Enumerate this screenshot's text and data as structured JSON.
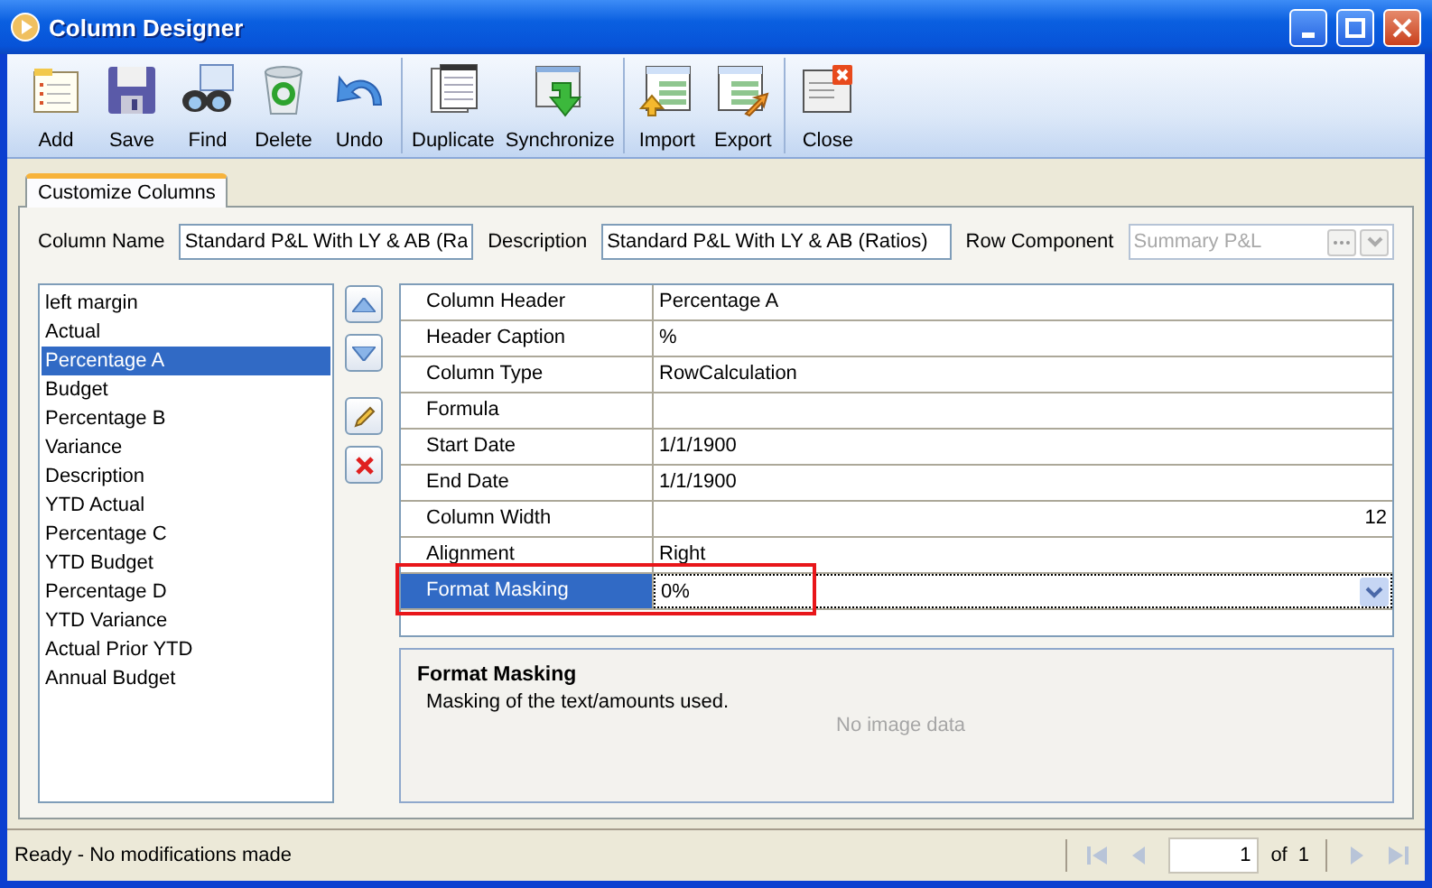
{
  "window": {
    "title": "Column Designer"
  },
  "toolbar": {
    "groups": [
      [
        {
          "label": "Add"
        },
        {
          "label": "Save"
        },
        {
          "label": "Find"
        },
        {
          "label": "Delete"
        },
        {
          "label": "Undo"
        }
      ],
      [
        {
          "label": "Duplicate"
        },
        {
          "label": "Synchronize"
        }
      ],
      [
        {
          "label": "Import"
        },
        {
          "label": "Export"
        }
      ],
      [
        {
          "label": "Close"
        }
      ]
    ]
  },
  "tabs": [
    {
      "label": "Customize Columns",
      "selected": true
    }
  ],
  "form": {
    "column_name": {
      "label": "Column Name",
      "value": "Standard P&L With LY & AB (Ra"
    },
    "description": {
      "label": "Description",
      "value": "Standard P&L With LY & AB (Ratios)"
    },
    "row_component": {
      "label": "Row Component",
      "value": "Summary P&L",
      "disabled": true
    }
  },
  "columns_list": [
    {
      "label": "left margin",
      "selected": false
    },
    {
      "label": "Actual",
      "selected": false
    },
    {
      "label": "Percentage A",
      "selected": true
    },
    {
      "label": "Budget",
      "selected": false
    },
    {
      "label": "Percentage B",
      "selected": false
    },
    {
      "label": "Variance",
      "selected": false
    },
    {
      "label": "Description",
      "selected": false
    },
    {
      "label": "YTD Actual",
      "selected": false
    },
    {
      "label": "Percentage C",
      "selected": false
    },
    {
      "label": "YTD Budget",
      "selected": false
    },
    {
      "label": "Percentage D",
      "selected": false
    },
    {
      "label": "YTD Variance",
      "selected": false
    },
    {
      "label": "Actual Prior YTD",
      "selected": false
    },
    {
      "label": "Annual Budget",
      "selected": false
    }
  ],
  "properties": [
    {
      "name": "Column Header",
      "value": "Percentage A",
      "kind": "text",
      "selected": false,
      "highlighted": false
    },
    {
      "name": "Header Caption",
      "value": "%",
      "kind": "text",
      "selected": false,
      "highlighted": false
    },
    {
      "name": "Column Type",
      "value": "RowCalculation",
      "kind": "text",
      "selected": false,
      "highlighted": false
    },
    {
      "name": "Formula",
      "kind": "text",
      "selected": false,
      "highlighted": false
    },
    {
      "name": "Start Date",
      "value": "1/1/1900",
      "kind": "text",
      "selected": false,
      "highlighted": false
    },
    {
      "name": "End Date",
      "value": "1/1/1900",
      "kind": "text",
      "selected": false,
      "highlighted": false
    },
    {
      "name": "Column Width",
      "value": "12",
      "kind": "number",
      "selected": false,
      "highlighted": false
    },
    {
      "name": "Alignment",
      "value": "Right",
      "kind": "text",
      "selected": false,
      "highlighted": false
    },
    {
      "name": "Format Masking",
      "value": "0%",
      "kind": "dropdown",
      "selected": true,
      "highlighted": true
    }
  ],
  "help_panel": {
    "title": "Format Masking",
    "text": "Masking of the text/amounts used.",
    "empty_image_text": "No image data"
  },
  "status_bar": {
    "message": "Ready - No modifications made",
    "page": "1",
    "of_label": "of",
    "total": "1"
  }
}
